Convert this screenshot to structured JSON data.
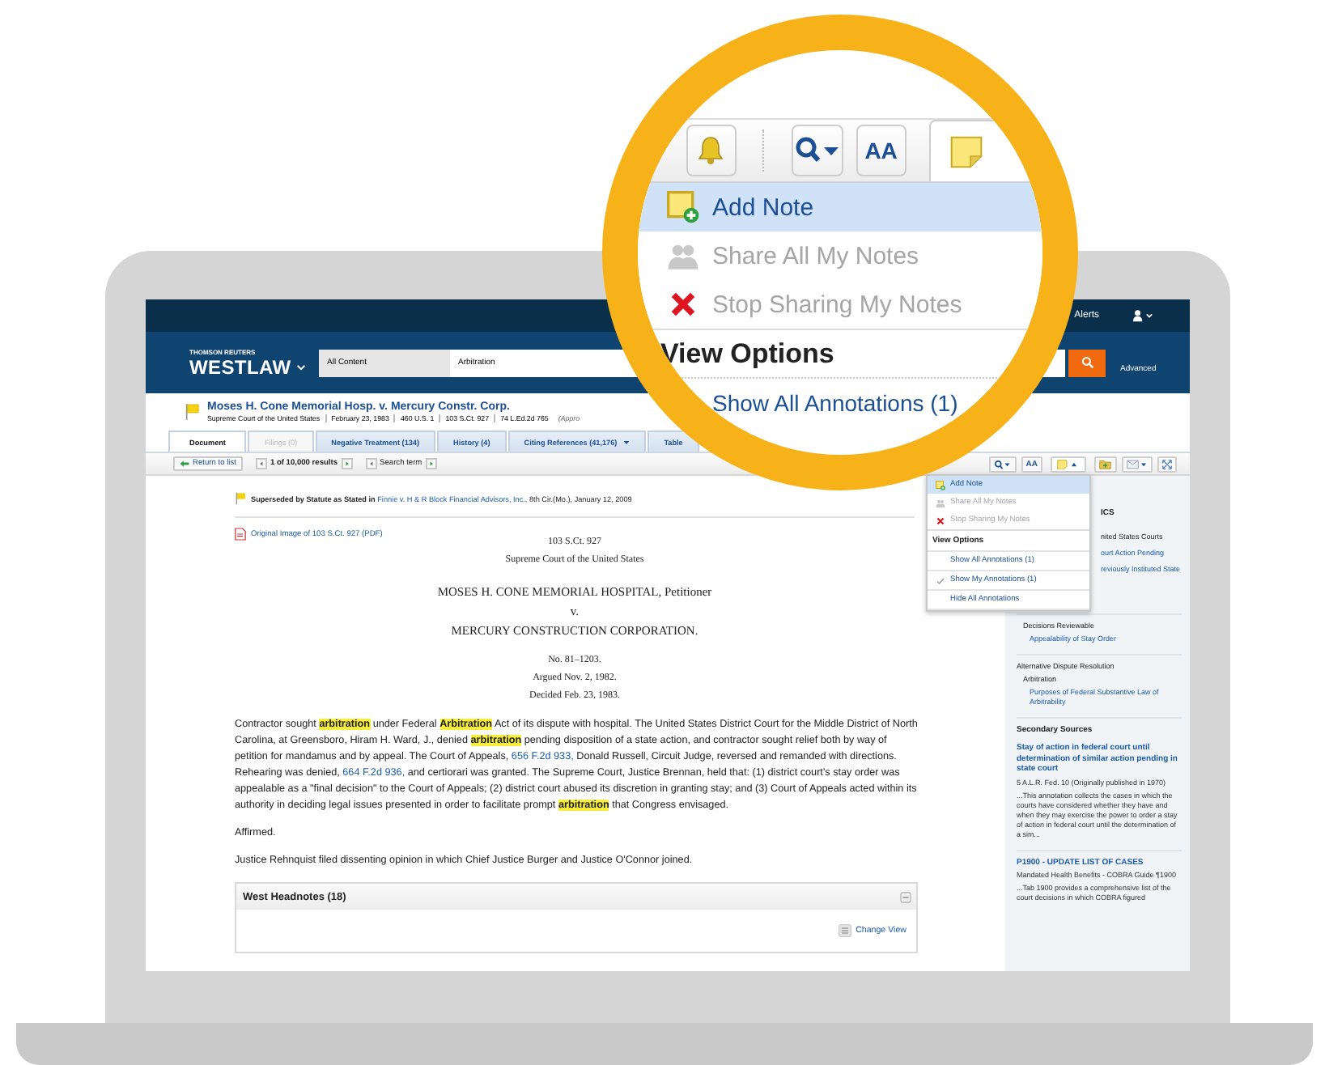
{
  "topbar": {
    "alerts": "Alerts"
  },
  "header": {
    "brand_top": "THOMSON REUTERS",
    "brand": "WESTLAW",
    "scope": "All Content",
    "query": "Arbitration",
    "advanced": "Advanced"
  },
  "case": {
    "title": "Moses H. Cone Memorial Hosp. v. Mercury Constr. Corp.",
    "meta": [
      "Supreme Court of the United States",
      "February 23, 1983",
      "460 U.S. 1",
      "103 S.Ct. 927",
      "74 L.Ed.2d 765",
      "(Appro"
    ]
  },
  "tabs": [
    {
      "label": "Document",
      "selected": true,
      "disabled": false,
      "dropdown": false
    },
    {
      "label": "Filings (0)",
      "selected": false,
      "disabled": true,
      "dropdown": false
    },
    {
      "label": "Negative Treatment (134)",
      "selected": false,
      "disabled": false,
      "dropdown": false
    },
    {
      "label": "History (4)",
      "selected": false,
      "disabled": false,
      "dropdown": false
    },
    {
      "label": "Citing References (41,176)",
      "selected": false,
      "disabled": false,
      "dropdown": true
    },
    {
      "label": "Table",
      "selected": false,
      "disabled": false,
      "dropdown": false
    }
  ],
  "toolbar": {
    "return": "Return to list",
    "results": "1 of 10,000 results",
    "search_term": "Search term",
    "font": "AA"
  },
  "note_menu": {
    "items": [
      {
        "kind": "add",
        "label": "Add Note",
        "selected": true,
        "disabled": false
      },
      {
        "kind": "share",
        "label": "Share All My Notes",
        "selected": false,
        "disabled": true
      },
      {
        "kind": "unshare",
        "label": "Stop Sharing My Notes",
        "selected": false,
        "disabled": true
      },
      {
        "kind": "header",
        "label": "View Options"
      },
      {
        "kind": "option",
        "label": "Show All Annotations (1)",
        "checked": false
      },
      {
        "kind": "option",
        "label": "Show My Annotations (1)",
        "checked": true
      },
      {
        "kind": "option",
        "label": "Hide All Annotations",
        "checked": false
      }
    ]
  },
  "document": {
    "history": {
      "label": "Superseded by Statute as Stated in",
      "link": "Finnie v. H & R Block Financial Advisors, Inc.,",
      "rest": "8th Cir.(Mo.), January 12, 2009"
    },
    "pdf_link": "Original Image of 103 S.Ct. 927 (PDF)",
    "caption": [
      {
        "kind": "court",
        "lines": [
          "103 S.Ct. 927",
          "Supreme Court of the United States"
        ]
      },
      {
        "kind": "parties",
        "lines": [
          "MOSES H. CONE MEMORIAL HOSPITAL, Petitioner",
          "v.",
          "MERCURY CONSTRUCTION CORPORATION."
        ]
      },
      {
        "kind": "docket",
        "lines": [
          "No. 81–1203.",
          "Argued Nov. 2, 1982.",
          "Decided Feb. 23, 1983."
        ]
      }
    ],
    "synopsis": [
      {
        "kind": "text",
        "text": "Contractor sought "
      },
      {
        "kind": "hit",
        "text": "arbitration"
      },
      {
        "kind": "text",
        "text": " under Federal "
      },
      {
        "kind": "hit",
        "text": "Arbitration"
      },
      {
        "kind": "text",
        "text": " Act of its dispute with hospital. The United States District Court for the Middle District of North Carolina, at Greensboro, Hiram H. Ward, J., denied "
      },
      {
        "kind": "hit",
        "text": "arbitration"
      },
      {
        "kind": "text",
        "text": " pending disposition of a state action, and contractor sought relief both by way of petition for mandamus and by appeal. The Court of Appeals, "
      },
      {
        "kind": "link",
        "text": "656 F.2d 933,"
      },
      {
        "kind": "text",
        "text": " Donald Russell, Circuit Judge, reversed and remanded with directions. Rehearing was denied, "
      },
      {
        "kind": "link",
        "text": "664 F.2d 936,"
      },
      {
        "kind": "text",
        "text": " and certiorari was granted. The Supreme Court, Justice Brennan, held that: (1) district court's stay order was appealable as a \"final decision\" to the Court of Appeals; (2) district court abused its discretion in granting stay; and (3) Court of Appeals acted within its authority in deciding legal issues presented in order to facilitate prompt "
      },
      {
        "kind": "hit",
        "text": "arbitration"
      },
      {
        "kind": "text",
        "text": " that Congress envisaged."
      }
    ],
    "paragraphs": [
      "Affirmed.",
      "Justice Rehnquist filed dissenting opinion in which Chief Justice Burger and Justice O'Connor joined."
    ],
    "headnotes": {
      "title": "West Headnotes (18)",
      "change_view": "Change View",
      "expanded": true
    }
  },
  "sidebar": {
    "groups": [
      {
        "items": [
          {
            "kind": "heading",
            "text": "ICS"
          },
          {
            "kind": "topic",
            "text": "nited States Courts"
          },
          {
            "kind": "link",
            "text": "ourt Action Pending"
          },
          {
            "kind": "link",
            "text": "reviously Instituted State"
          }
        ]
      },
      {
        "items": [
          {
            "kind": "subtopic",
            "text": "Decisions Reviewable"
          },
          {
            "kind": "sublink",
            "text": "Appealability of Stay Order"
          }
        ]
      },
      {
        "items": [
          {
            "kind": "topic",
            "text": "Alternative Dispute Resolution"
          },
          {
            "kind": "subtopic",
            "text": "Arbitration"
          },
          {
            "kind": "sublink",
            "text": "Purposes of Federal Substantive Law of Arbitrability"
          }
        ]
      },
      {
        "items": [
          {
            "kind": "heading",
            "text": "Secondary Sources"
          },
          {
            "kind": "title",
            "text": "Stay of action in federal court until determination of similar action pending in state court"
          },
          {
            "kind": "meta",
            "text": "5 A.L.R. Fed. 10 (Originally published in 1970)"
          },
          {
            "kind": "snippet",
            "text": "...This annotation collects the cases in which the courts have considered whether they have and when they may exercise the power to order a stay of action in federal court until the determination of a sim..."
          }
        ]
      },
      {
        "items": [
          {
            "kind": "title",
            "text": "P1900 - UPDATE LIST OF CASES"
          },
          {
            "kind": "meta",
            "text": "Mandated Health Benefits - COBRA Guide ¶1900"
          },
          {
            "kind": "snippet",
            "text": "...Tab 1900 provides a comprehensive list of the court decisions in which COBRA figured"
          }
        ]
      }
    ]
  },
  "magnifier": {
    "font": "AA",
    "items": [
      {
        "kind": "add",
        "label": "Add Note",
        "selected": true,
        "disabled": false
      },
      {
        "kind": "share",
        "label": "Share All My Notes",
        "selected": false,
        "disabled": true
      },
      {
        "kind": "unshare",
        "label": "Stop Sharing My Notes",
        "selected": false,
        "disabled": true
      },
      {
        "kind": "header",
        "label": "View Options"
      },
      {
        "kind": "option",
        "label": "Show All Annotations (1)"
      }
    ]
  }
}
